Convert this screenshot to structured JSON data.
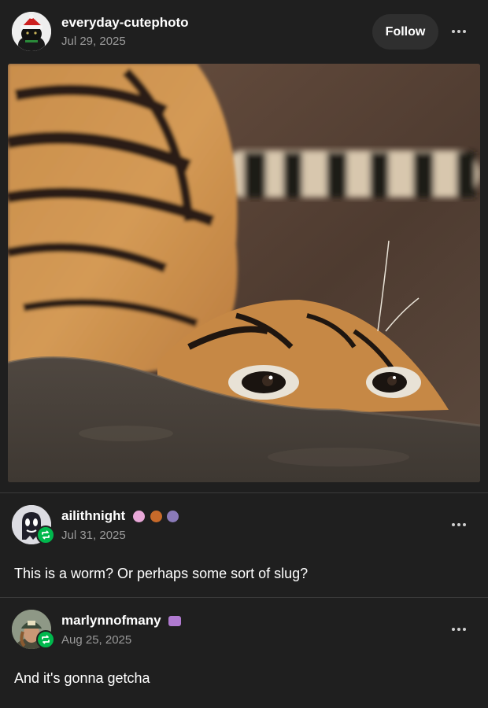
{
  "post": {
    "username": "everyday-cutephoto",
    "date": "Jul 29, 2025",
    "follow_label": "Follow",
    "avatar_icon": "black-cat-with-santa-hat-avatar",
    "photo_icon": "tiger-peeking-over-rock-photo"
  },
  "reblogs": [
    {
      "username": "ailithnight",
      "date": "Jul 31, 2025",
      "text": "This is a worm? Or perhaps some sort of slug?",
      "avatar_icon": "ghost-avatar",
      "badge_icon": "reblog-icon",
      "badges": [
        "pink-creature-badge",
        "paw-badge",
        "purple-creature-badge"
      ]
    },
    {
      "username": "marlynnofmany",
      "date": "Aug 25, 2025",
      "text": "And it's gonna getcha",
      "avatar_icon": "person-in-cap-avatar",
      "badge_icon": "reblog-icon",
      "badges": [
        "typewriter-badge"
      ]
    }
  ],
  "colors": {
    "background": "#1f1f1f",
    "reblog_badge": "#00b84d",
    "date_text": "#9a9a9a",
    "follow_button": "#2f2f2f"
  }
}
